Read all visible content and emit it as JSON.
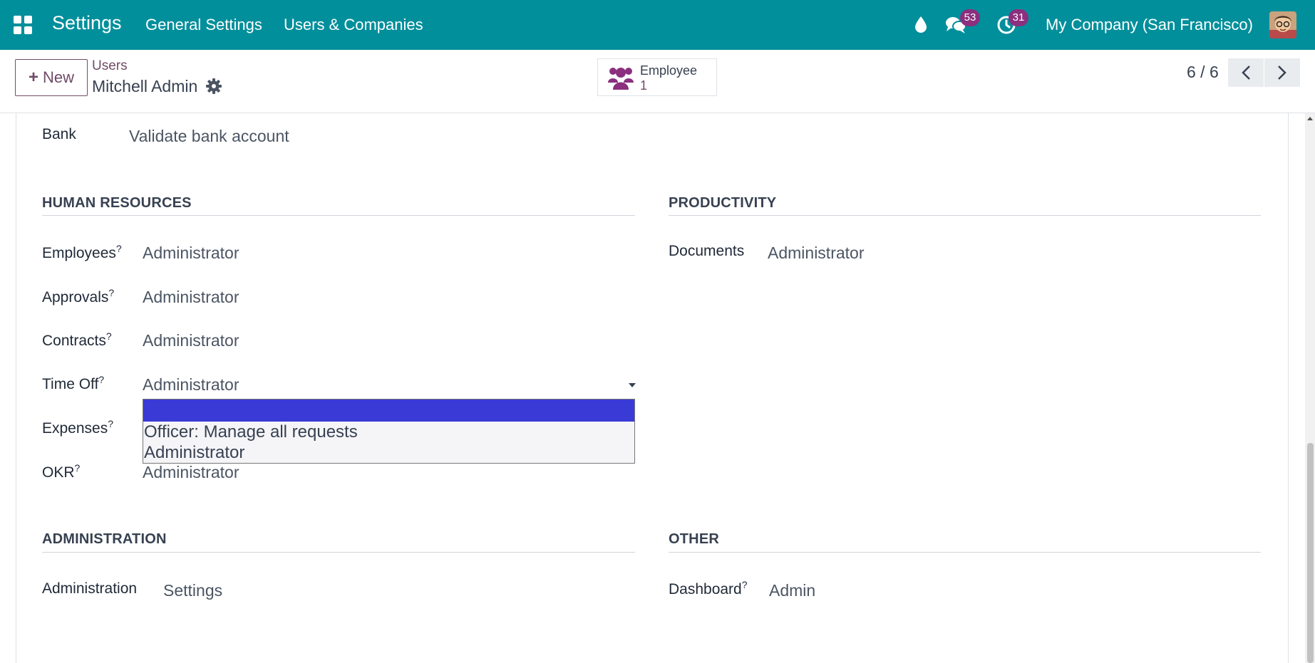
{
  "navbar": {
    "app_name": "Settings",
    "menu": [
      "General Settings",
      "Users & Companies"
    ],
    "messages_count": "53",
    "activities_count": "31",
    "company": "My Company (San Francisco)"
  },
  "control_panel": {
    "new_label": "New",
    "breadcrumb_parent": "Users",
    "breadcrumb_current": "Mitchell Admin",
    "stat_button": {
      "label": "Employee",
      "value": "1"
    },
    "pager": "6 / 6"
  },
  "form": {
    "bank": {
      "label": "Bank",
      "value": "Validate bank account"
    },
    "human_resources": {
      "title": "HUMAN RESOURCES",
      "fields": [
        {
          "label": "Employees",
          "help": "?",
          "value": "Administrator"
        },
        {
          "label": "Approvals",
          "help": "?",
          "value": "Administrator"
        },
        {
          "label": "Contracts",
          "help": "?",
          "value": "Administrator"
        },
        {
          "label": "Time Off",
          "help": "?",
          "value": "Administrator"
        },
        {
          "label": "Expenses",
          "help": "?",
          "value": ""
        },
        {
          "label": "OKR",
          "help": "?",
          "value": "Administrator"
        }
      ]
    },
    "productivity": {
      "title": "PRODUCTIVITY",
      "fields": [
        {
          "label": "Documents",
          "value": "Administrator"
        }
      ]
    },
    "administration": {
      "title": "ADMINISTRATION",
      "fields": [
        {
          "label": "Administration",
          "value": "Settings"
        }
      ]
    },
    "other": {
      "title": "OTHER",
      "fields": [
        {
          "label": "Dashboard",
          "help": "?",
          "value": "Admin"
        }
      ]
    }
  },
  "time_off_dropdown": {
    "options": [
      "",
      "Officer: Manage all requests",
      "Administrator"
    ],
    "highlighted_index": 0
  },
  "colors": {
    "navbar": "#018f9b",
    "brand": "#714b67",
    "badge": "#8b2f7e",
    "dropdown_highlight": "#3a3ad6"
  }
}
